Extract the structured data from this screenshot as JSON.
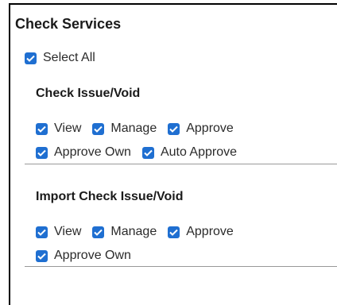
{
  "panel": {
    "title": "Check Services",
    "select_all_label": "Select All"
  },
  "sections": [
    {
      "title": "Check Issue/Void",
      "checkboxes": [
        {
          "label": "View",
          "checked": true
        },
        {
          "label": "Manage",
          "checked": true
        },
        {
          "label": "Approve",
          "checked": true
        },
        {
          "label": "Approve Own",
          "checked": true
        },
        {
          "label": "Auto Approve",
          "checked": true
        }
      ]
    },
    {
      "title": "Import Check Issue/Void",
      "checkboxes": [
        {
          "label": "View",
          "checked": true
        },
        {
          "label": "Manage",
          "checked": true
        },
        {
          "label": "Approve",
          "checked": true
        },
        {
          "label": "Approve Own",
          "checked": true
        }
      ]
    }
  ],
  "colors": {
    "checkbox_fill": "#1f6fd1",
    "divider": "#999999"
  }
}
